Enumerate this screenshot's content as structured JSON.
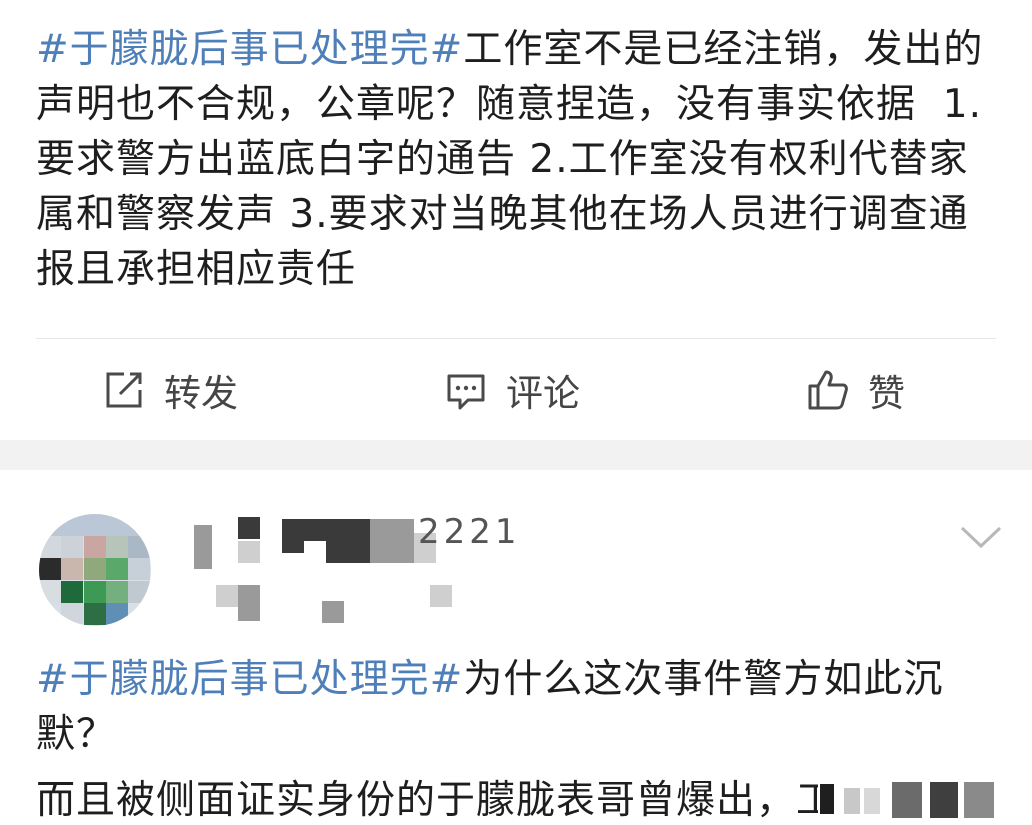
{
  "post1": {
    "topic": "#于朦胧后事已处理完#",
    "body": "工作室不是已经注销，发出的声明也不合规，公章呢？随意捏造，没有事实依据  1.要求警方出蓝底白字的通告 2.工作室没有权利代替家属和警察发声 3.要求对当晚其他在场人员进行调查通报且承担相应责任"
  },
  "actions": {
    "repost_label": "转发",
    "comment_label": "评论",
    "like_label": "赞",
    "repost_icon": "repost-icon",
    "comment_icon": "comment-icon",
    "like_icon": "thumbs-up-icon"
  },
  "post2": {
    "username_tail": "2221",
    "topic": "#于朦胧后事已处理完#",
    "body_line1": "为什么这次事件警方如此沉默？",
    "body_line2": "而且被侧面证实身份的于朦胧表哥曾爆出，工作室"
  },
  "colors": {
    "topic": "#4e7fb8",
    "text": "#1e1e1e",
    "action_text": "#454545",
    "separator_band": "#f2f2f2"
  }
}
